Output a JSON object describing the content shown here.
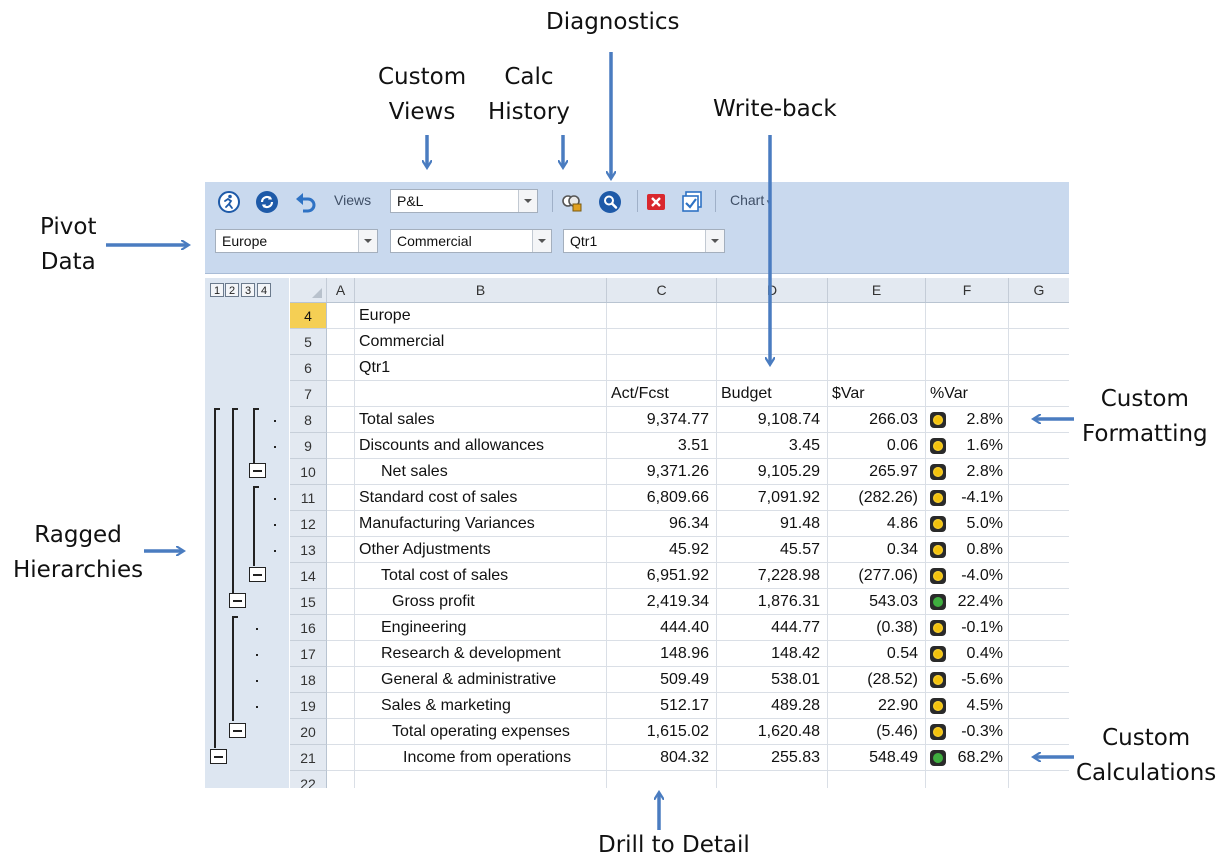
{
  "callouts": {
    "diagnostics": "Diagnostics",
    "custom_views": [
      "Custom",
      "Views"
    ],
    "calc_history": [
      "Calc",
      "History"
    ],
    "write_back": "Write-back",
    "pivot_data": [
      "Pivot",
      "Data"
    ],
    "custom_formatting": [
      "Custom",
      "Formatting"
    ],
    "ragged_hierarchies": [
      "Ragged",
      "Hierarchies"
    ],
    "custom_calculations": [
      "Custom",
      "Calculations"
    ],
    "drill_to_detail": "Drill to Detail"
  },
  "toolbar": {
    "views_label": "Views",
    "views_value": "P&L",
    "chart_label": "Chart",
    "icons": [
      "run-icon",
      "refresh-icon",
      "undo-icon",
      "calc-history-icon",
      "diagnostics-icon",
      "close-icon",
      "writeback-icon"
    ],
    "filters": [
      "Europe",
      "Commercial",
      "Qtr1"
    ]
  },
  "outline_levels": [
    "1",
    "2",
    "3",
    "4"
  ],
  "columns": [
    "A",
    "B",
    "C",
    "D",
    "E",
    "F",
    "G"
  ],
  "rows": [
    {
      "n": "4",
      "label": "Europe",
      "indent": 0,
      "c": "",
      "d": "",
      "e": "",
      "f": "",
      "light": ""
    },
    {
      "n": "5",
      "label": "Commercial",
      "indent": 0,
      "c": "",
      "d": "",
      "e": "",
      "f": "",
      "light": ""
    },
    {
      "n": "6",
      "label": "Qtr1",
      "indent": 0,
      "c": "",
      "d": "",
      "e": "",
      "f": "",
      "light": ""
    },
    {
      "n": "7",
      "label": "",
      "indent": 0,
      "c": "Act/Fcst",
      "d": "Budget",
      "e": "$Var",
      "f": "%Var",
      "light": "",
      "header": true
    },
    {
      "n": "8",
      "label": "Total sales",
      "indent": 0,
      "c": "9,374.77",
      "d": "9,108.74",
      "e": "266.03",
      "f": "2.8%",
      "light": "yellow"
    },
    {
      "n": "9",
      "label": "Discounts and allowances",
      "indent": 0,
      "c": "3.51",
      "d": "3.45",
      "e": "0.06",
      "f": "1.6%",
      "light": "yellow"
    },
    {
      "n": "10",
      "label": "Net sales",
      "indent": 1,
      "c": "9,371.26",
      "d": "9,105.29",
      "e": "265.97",
      "f": "2.8%",
      "light": "yellow"
    },
    {
      "n": "11",
      "label": "Standard cost of sales",
      "indent": 0,
      "c": "6,809.66",
      "d": "7,091.92",
      "e": "(282.26)",
      "f": "-4.1%",
      "light": "yellow"
    },
    {
      "n": "12",
      "label": "Manufacturing Variances",
      "indent": 0,
      "c": "96.34",
      "d": "91.48",
      "e": "4.86",
      "f": "5.0%",
      "light": "yellow"
    },
    {
      "n": "13",
      "label": "Other Adjustments",
      "indent": 0,
      "c": "45.92",
      "d": "45.57",
      "e": "0.34",
      "f": "0.8%",
      "light": "yellow"
    },
    {
      "n": "14",
      "label": "Total cost of sales",
      "indent": 1,
      "c": "6,951.92",
      "d": "7,228.98",
      "e": "(277.06)",
      "f": "-4.0%",
      "light": "yellow"
    },
    {
      "n": "15",
      "label": "Gross profit",
      "indent": 2,
      "c": "2,419.34",
      "d": "1,876.31",
      "e": "543.03",
      "f": "22.4%",
      "light": "green"
    },
    {
      "n": "16",
      "label": "Engineering",
      "indent": 1,
      "c": "444.40",
      "d": "444.77",
      "e": "(0.38)",
      "f": "-0.1%",
      "light": "yellow"
    },
    {
      "n": "17",
      "label": "Research & development",
      "indent": 1,
      "c": "148.96",
      "d": "148.42",
      "e": "0.54",
      "f": "0.4%",
      "light": "yellow"
    },
    {
      "n": "18",
      "label": "General & administrative",
      "indent": 1,
      "c": "509.49",
      "d": "538.01",
      "e": "(28.52)",
      "f": "-5.6%",
      "light": "yellow"
    },
    {
      "n": "19",
      "label": "Sales & marketing",
      "indent": 1,
      "c": "512.17",
      "d": "489.28",
      "e": "22.90",
      "f": "4.5%",
      "light": "yellow"
    },
    {
      "n": "20",
      "label": "Total operating expenses",
      "indent": 2,
      "c": "1,615.02",
      "d": "1,620.48",
      "e": "(5.46)",
      "f": "-0.3%",
      "light": "yellow"
    },
    {
      "n": "21",
      "label": "Income from operations",
      "indent": 3,
      "c": "804.32",
      "d": "255.83",
      "e": "548.49",
      "f": "68.2%",
      "light": "green"
    },
    {
      "n": "22",
      "label": "",
      "indent": 0,
      "c": "",
      "d": "",
      "e": "",
      "f": "",
      "light": ""
    }
  ],
  "colors": {
    "accent_arrow": "#4a7cc0",
    "toolbar_bg": "#c9d9ee",
    "selected_row": "#f5cf54"
  }
}
